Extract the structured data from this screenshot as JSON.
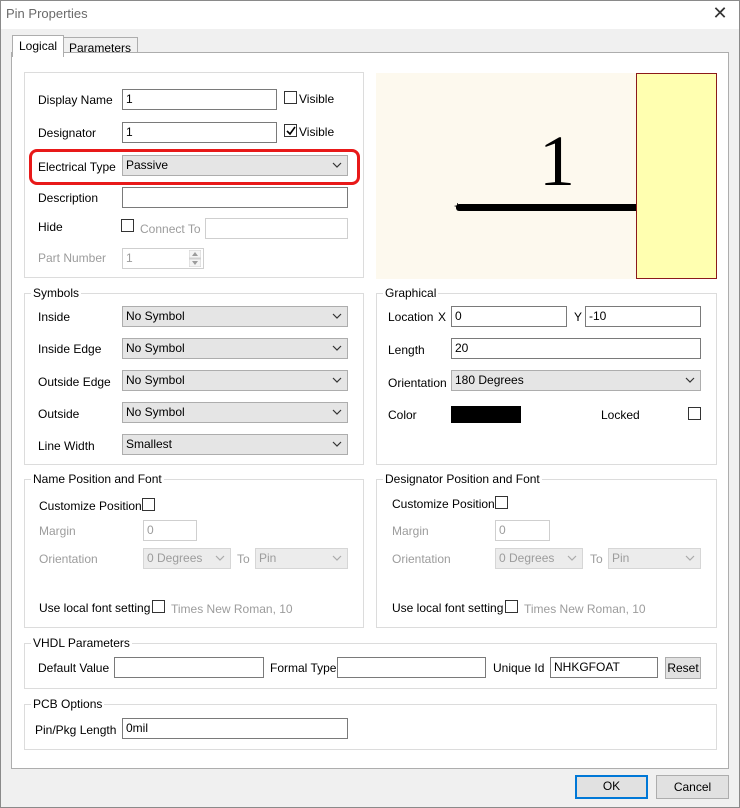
{
  "window": {
    "title": "Pin Properties"
  },
  "tabs": [
    {
      "label": "Logical"
    },
    {
      "label": "Parameters"
    }
  ],
  "main": {
    "display_name": {
      "label": "Display Name",
      "value": "1",
      "visible_label": "Visible",
      "visible_checked": false
    },
    "designator": {
      "label": "Designator",
      "value": "1",
      "visible_label": "Visible",
      "visible_checked": true
    },
    "electrical_type": {
      "label": "Electrical Type",
      "value": "Passive"
    },
    "description": {
      "label": "Description",
      "value": ""
    },
    "hide": {
      "label": "Hide",
      "checked": false,
      "connect_to_label": "Connect To",
      "connect_to_value": ""
    },
    "part_number": {
      "label": "Part Number",
      "value": "1"
    }
  },
  "preview": {
    "pin_label": "1",
    "body_color": "#ffffb0"
  },
  "symbols": {
    "title": "Symbols",
    "inside": {
      "label": "Inside",
      "value": "No Symbol"
    },
    "inside_edge": {
      "label": "Inside Edge",
      "value": "No Symbol"
    },
    "outside_edge": {
      "label": "Outside Edge",
      "value": "No Symbol"
    },
    "outside": {
      "label": "Outside",
      "value": "No Symbol"
    },
    "line_width": {
      "label": "Line Width",
      "value": "Smallest"
    }
  },
  "graphical": {
    "title": "Graphical",
    "location_label": "Location",
    "x_label": "X",
    "x_value": "0",
    "y_label": "Y",
    "y_value": "-10",
    "length_label": "Length",
    "length_value": "20",
    "orientation_label": "Orientation",
    "orientation_value": "180 Degrees",
    "color_label": "Color",
    "color_value": "#000000",
    "locked_label": "Locked",
    "locked_checked": false
  },
  "name_position": {
    "title": "Name Position and Font",
    "customize_label": "Customize Position",
    "margin_label": "Margin",
    "margin_value": "0",
    "orientation_label": "Orientation",
    "orientation_value": "0 Degrees",
    "to_label": "To",
    "to_value": "Pin",
    "font_label": "Use local font setting",
    "font_value": "Times New Roman, 10"
  },
  "designator_position": {
    "title": "Designator Position and Font",
    "customize_label": "Customize Position",
    "margin_label": "Margin",
    "margin_value": "0",
    "orientation_label": "Orientation",
    "orientation_value": "0 Degrees",
    "to_label": "To",
    "to_value": "Pin",
    "font_label": "Use local font setting",
    "font_value": "Times New Roman, 10"
  },
  "vhdl": {
    "title": "VHDL Parameters",
    "default_value_label": "Default Value",
    "default_value": "",
    "formal_type_label": "Formal Type",
    "formal_type": "",
    "unique_id_label": "Unique Id",
    "unique_id": "NHKGFOAT",
    "reset_label": "Reset"
  },
  "pcb": {
    "title": "PCB Options",
    "pin_pkg_label": "Pin/Pkg Length",
    "pin_pkg_value": "0mil"
  },
  "footer": {
    "ok_label": "OK",
    "cancel_label": "Cancel"
  }
}
